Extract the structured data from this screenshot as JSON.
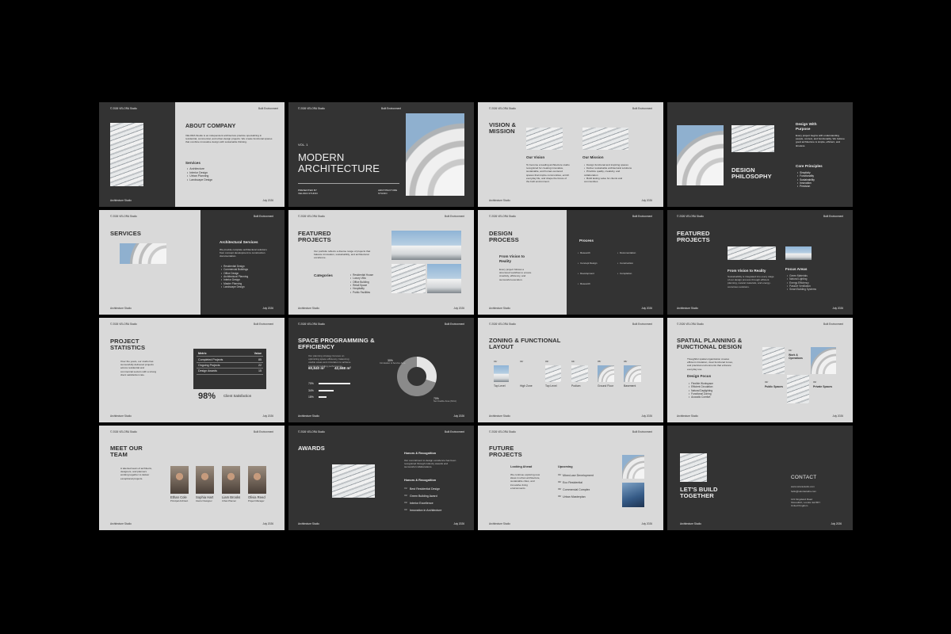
{
  "common": {
    "copyright": "© 2026 VELORA Studio",
    "env": "Built Environment",
    "studio": "Architecture Studio",
    "date": "July 2026"
  },
  "s1": {
    "title": "ABOUT COMPANY",
    "intro": "VELORA Studio is an independent architecture practice specializing in residential, commercial, and urban design projects. We create functional spaces that combine innovative design with sustainable thinking.",
    "services_title": "Services",
    "services": [
      "Architecture",
      "Interior Design",
      "Urban Planning",
      "Landscape Design"
    ]
  },
  "s2": {
    "vol": "VOL. 1",
    "title": "MODERN ARCHITECTURE",
    "presented": "PRESENTED BY VELORA STUDIO",
    "studio_tag": "ARCHITECTURE STUDIO"
  },
  "s3": {
    "title": "VISION & MISSION",
    "vision_h": "Our Vision",
    "vision": "To become a leading architecture studio recognized for creating innovative, sustainable, and human-centered spaces that inspire communities, enrich everyday life, and shape the future of the built environment.",
    "mission_h": "Our Mission",
    "mission": [
      "Design functional and inspiring spaces",
      "Deliver sustainable architectural solutions",
      "Prioritize quality, creativity, and collaboration",
      "Build lasting value for clients and communities"
    ]
  },
  "s4": {
    "title": "DESIGN PHILOSOPHY",
    "purpose_h": "Design With Purpose",
    "purpose": "Every project begins with understanding people, context, and functionality. We believe good architecture is simple, efficient, and timeless.",
    "core_h": "Core Principles",
    "core": [
      "Simplicity",
      "Functionality",
      "Sustainability",
      "Innovation",
      "Precision"
    ]
  },
  "s5": {
    "title": "SERVICES",
    "arch_h": "Architectural Services",
    "arch": "We provide complete architectural solutions from concept development to construction documentation.",
    "list": [
      "Residential Design",
      "Commercial Buildings",
      "Office Design",
      "Architectural Planning",
      "Interior Design",
      "Master Planning",
      "Landscape Design"
    ]
  },
  "s6": {
    "title": "FEATURED PROJECTS",
    "intro": "Our portfolio reflects a diverse range of projects that balance innovation, sustainability, and architectural excellence.",
    "cat_h": "Categories",
    "cats": [
      "Residential House",
      "Luxury Villa",
      "Office Building",
      "Retail Space",
      "Hospitality",
      "Public Facilities"
    ]
  },
  "s7": {
    "title": "DESIGN PROCESS",
    "from_h": "From Vision to Reality",
    "from": "Every project follows a structured workflow to ensure creativity, efficiency, and successful execution.",
    "process_h": "Process",
    "steps": [
      "Research",
      "Concept Design",
      "Development",
      "Research",
      "Documentation",
      "Construction",
      "Completion"
    ]
  },
  "s8": {
    "title": "FEATURED PROJECTS",
    "from_h": "From Vision to Reality",
    "from": "Sustainability is integrated into every stage of our design process through efficient planning, natural materials, and energy-conscious solutions.",
    "focus_h": "Focus Areas",
    "focus": [
      "Green Materials",
      "Natural Lighting",
      "Energy Efficiency",
      "Passive Ventilation",
      "Smart Building Systems"
    ]
  },
  "s9": {
    "title": "PROJECT STATISTICS",
    "intro": "Over the years, our studio has successfully delivered projects across residential and commercial sectors with a strong client satisfaction rate.",
    "th": [
      "Metric",
      "Value"
    ],
    "rows": [
      [
        "Completed Projects",
        "85"
      ],
      [
        "Ongoing Projects",
        "22"
      ],
      [
        "Design Awards",
        "15"
      ]
    ],
    "big": "98%",
    "big_label": "Client Satisfaction"
  },
  "s10": {
    "title": "SPACE PROGRAMMING & EFFICIENCY",
    "intro": "Our planning strategy focuses on optimizing space efficiency, balancing usable areas and circulation to achieve functional building performance.",
    "m1": "60,840 m²",
    "m2": "42,668 m²",
    "pct": [
      "70%",
      "34%",
      "18%"
    ],
    "d1": "30%",
    "d1l": "Circulation & Service Area",
    "d2": "70%",
    "d2l": "Net Usable Area (NUA)"
  },
  "s11": {
    "title": "ZONING & FUNCTIONAL LAYOUT",
    "nums": [
      "01/",
      "02/",
      "03/",
      "04/",
      "05/",
      "06/"
    ],
    "levels": [
      "Top Level",
      "High Zone",
      "Top Level",
      "Podium",
      "Ground Floor",
      "Basement"
    ]
  },
  "s12": {
    "title": "SPATIAL PLANNING & FUNCTIONAL DESIGN",
    "intro": "Thoughtful spatial organization creates efficient circulation, clear functional zones, and practical environments that enhance everyday use.",
    "focus_h": "Design Focus",
    "focus": [
      "Flexible Workspace",
      "Efficient Circulation",
      "Natural Daylighting",
      "Functional Zoning",
      "Acoustic Comfort"
    ],
    "z1n": "01/",
    "z1": "Work & Operations",
    "z2n": "02/",
    "z2": "Public Spaces",
    "z3n": "03/",
    "z3": "Private Spaces"
  },
  "s13": {
    "title": "MEET OUR TEAM",
    "intro": "A talented team of architects, designers, and planners working together to deliver exceptional projects.",
    "members": [
      {
        "name": "Ethan Cole",
        "role": "Principal Architect"
      },
      {
        "name": "Sophia Hart",
        "role": "Interior Designer"
      },
      {
        "name": "Liam Brooks",
        "role": "Urban Planner"
      },
      {
        "name": "Olivia Reed",
        "role": "Project Manager"
      }
    ]
  },
  "s14": {
    "title": "AWARDS",
    "honors_h": "Honors & Recognition",
    "honors": "Our commitment to design excellence has been recognized through industry awards and successful collaborations.",
    "honors2_h": "Honors & Recognition",
    "awards": [
      "Best Residential Design",
      "Green Building Award",
      "Interior Excellence",
      "Innovation in Architecture"
    ],
    "nums": [
      "01/",
      "02/",
      "03/",
      "04/"
    ]
  },
  "s15": {
    "title": "FUTURE PROJECTS",
    "ahead_h": "Looking Ahead",
    "ahead": "We continue exploring new ideas in urban architecture, sustainable cities, and innovative living environments.",
    "up_h": "Upcoming",
    "up": [
      "Mixed-use Development",
      "Eco Residential",
      "Commercial Complex",
      "Urban Masterplan"
    ],
    "nums": [
      "01/",
      "02/",
      "03/",
      "04/"
    ]
  },
  "s16": {
    "title": "LET'S BUILD TOGETHER",
    "contact_h": "CONTACT",
    "email": "www.velorastudio.com",
    "mail": "hello@velorastudio.com",
    "addr1": "143 Kingsland Road",
    "addr2": "Shoreditch, London E2 8DY",
    "addr3": "United Kingdom"
  }
}
